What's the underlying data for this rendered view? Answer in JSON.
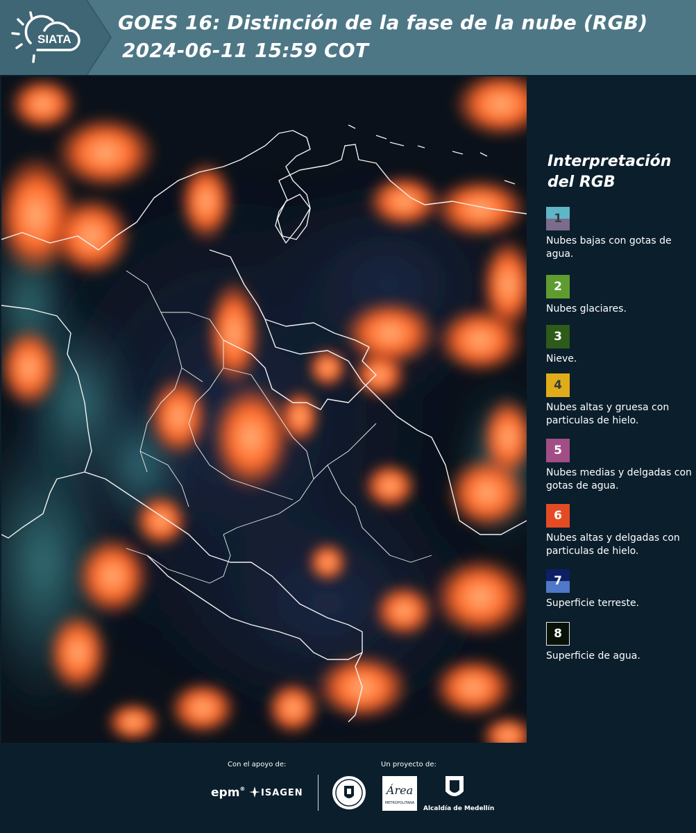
{
  "header": {
    "logo_text": "SIATA",
    "title_line1": "GOES 16: Distinción de la fase de la nube (RGB)",
    "title_line2": "2024-06-11 15:59 COT",
    "colors": {
      "left_band": "#3f6675",
      "right_band": "#4e7786"
    }
  },
  "legend": {
    "title_line1": "Interpretación",
    "title_line2": "del RGB",
    "items": [
      {
        "number": "1",
        "label": "Nubes bajas con gotas de agua.",
        "color_top": "#5fb6c6",
        "color_bottom": "#7a6c8a",
        "number_color": "#3a3a4a"
      },
      {
        "number": "2",
        "label": "Nubes glaciares.",
        "color_top": "#5f9c2f",
        "color_bottom": "#5f9c2f",
        "number_color": "#ffffff"
      },
      {
        "number": "3",
        "label": "Nieve.",
        "color_top": "#2e5a1a",
        "color_bottom": "#2e5a1a",
        "number_color": "#ffffff"
      },
      {
        "number": "4",
        "label": "Nubes altas y gruesa con particulas de hielo.",
        "color_top": "#e0ac1a",
        "color_bottom": "#e0ac1a",
        "number_color": "#3a3a3a"
      },
      {
        "number": "5",
        "label": "Nubes medias y delgadas con gotas de agua.",
        "color_top": "#a24e86",
        "color_bottom": "#a24e86",
        "number_color": "#ffffff"
      },
      {
        "number": "6",
        "label": "Nubes altas y delgadas con particulas de hielo.",
        "color_top": "#e44b25",
        "color_bottom": "#e44b25",
        "number_color": "#ffffff"
      },
      {
        "number": "7",
        "label": "Superficie terreste.",
        "color_top": "#0e1f63",
        "color_bottom": "#4f78c8",
        "number_color": "#ffffff"
      },
      {
        "number": "8",
        "label": "Superficie de agua.",
        "color_top": "#081208",
        "color_bottom": "#081208",
        "number_color": "#ffffff"
      }
    ]
  },
  "footer": {
    "support_label": "Con el apoyo de:",
    "project_label": "Un proyecto de:",
    "epm_text": "epm",
    "isagen_text": "ISAGEN",
    "area_text": "Área",
    "area_sub": "METROPOLITANA",
    "alcaldia_text": "Alcaldía de Medellín"
  }
}
